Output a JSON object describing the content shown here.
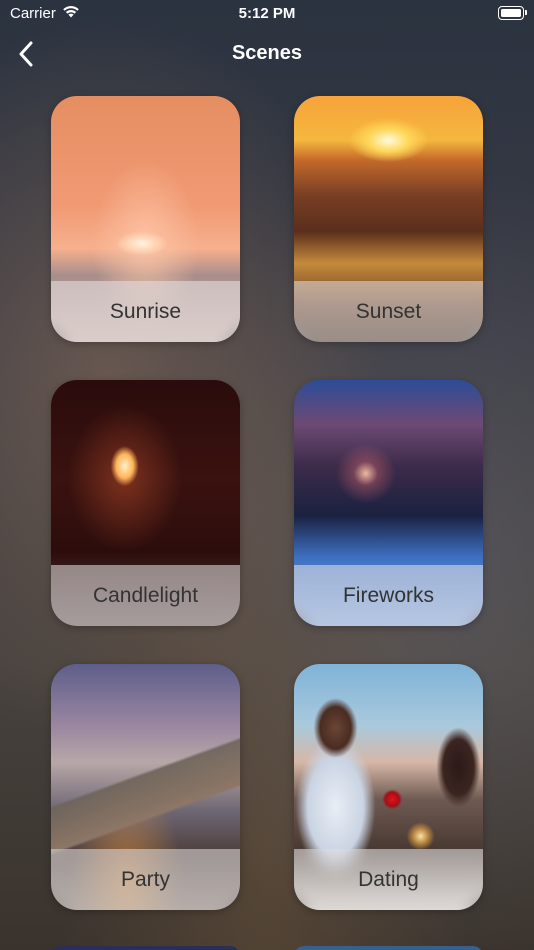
{
  "status_bar": {
    "carrier": "Carrier",
    "time": "5:12 PM",
    "wifi_icon": "wifi-icon",
    "battery_icon": "battery-icon"
  },
  "nav": {
    "back_icon": "chevron-left-icon",
    "title": "Scenes"
  },
  "scenes": [
    {
      "label": "Sunrise",
      "image": "sunrise-image"
    },
    {
      "label": "Sunset",
      "image": "sunset-image"
    },
    {
      "label": "Candlelight",
      "image": "candlelight-image"
    },
    {
      "label": "Fireworks",
      "image": "fireworks-image"
    },
    {
      "label": "Party",
      "image": "party-image"
    },
    {
      "label": "Dating",
      "image": "dating-image"
    }
  ],
  "colors": {
    "label_band": "#e6e4e4",
    "label_text": "#333333",
    "title_text": "#ffffff"
  }
}
